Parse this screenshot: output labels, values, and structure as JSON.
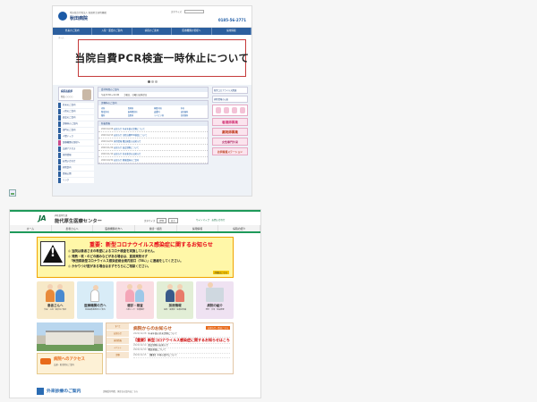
{
  "shot1": {
    "subtitle": "地方独立行政法人 秋田県立病院機構",
    "name": "秋田病院",
    "font_size_label": "文字サイズ",
    "phone": "0185-56-2771",
    "nav": [
      "外来のご案内",
      "入院・面会のご案内",
      "病院のご案内",
      "医療機関の皆様へ",
      "採用情報"
    ],
    "breadcrumb": "ホーム",
    "banner_text": "当院自費PCR検査一時休止について",
    "director": {
      "label": "病院長挨拶",
      "name": "院長 ○○○○"
    },
    "left_nav": [
      {
        "label": "外来のご案内",
        "alt": false
      },
      {
        "label": "入院のご案内",
        "alt": false
      },
      {
        "label": "面会のご案内",
        "alt": false
      },
      {
        "label": "診療科のご案内",
        "alt": false
      },
      {
        "label": "部門のご案内",
        "alt": false
      },
      {
        "label": "人間ドック",
        "alt": false
      },
      {
        "label": "医療機関の皆様へ",
        "alt": true
      },
      {
        "label": "交通アクセス",
        "alt": false
      },
      {
        "label": "採用情報",
        "alt": false
      },
      {
        "label": "お問い合わせ",
        "alt": false
      },
      {
        "label": "病院案内",
        "alt": false
      },
      {
        "label": "情報公開",
        "alt": false
      },
      {
        "label": "リンク",
        "alt": false
      }
    ],
    "hours_box": {
      "heading": "受付時間のご案内",
      "row": "午前 8:30〜11:00　　土曜日、日曜日は休診日"
    },
    "dept_box": {
      "heading": "診療科のご案内",
      "items": [
        "内科",
        "精神科",
        "神経内科",
        "外科",
        "整形外科",
        "脳神経外科",
        "皮膚科",
        "泌尿器科",
        "眼科",
        "耳鼻科",
        "リハビリ科",
        "放射線科"
      ]
    },
    "news_box": {
      "heading": "新着情報",
      "items": [
        {
          "date": "2020/12/28",
          "title": "お知らせ 年末年始の診療について"
        },
        {
          "date": "2020/12/15",
          "title": "お知らせ 当院自費PCR検査について"
        },
        {
          "date": "2020/12/01",
          "title": "採用情報 職員募集のお知らせ"
        },
        {
          "date": "2020/11/20",
          "title": "お知らせ 面会制限について"
        },
        {
          "date": "2020/11/10",
          "title": "お知らせ 外来休診のお知らせ"
        },
        {
          "date": "2020/10/30",
          "title": "お知らせ 健康講座のご案内"
        }
      ]
    },
    "right": {
      "box1": "新型コロナウイルス関連",
      "box2": "病院情報の公表",
      "pink1": "看護師募集",
      "pink2": "薬剤師募集",
      "pink3": "女性専門外来",
      "pink4": "訪問看護ステーション"
    }
  },
  "shot2": {
    "logo": "JA",
    "subtitle": "JA秋田厚生連",
    "name": "能代厚生医療センター",
    "font_label": "文字サイズ",
    "font_buttons": [
      "標準",
      "拡大"
    ],
    "links": "サイトマップ　お問い合わせ",
    "nav": [
      "ホーム",
      "患者さんへ",
      "医療機関の方へ",
      "健診・検査",
      "採用情報",
      "病院の紹介"
    ],
    "alert": {
      "title": "重要：新型コロナウイルス感染症に関するお知らせ",
      "lines": [
        "◎ 当院は患者さまの希望によるコロナ検査を実施していません。",
        "◎ 発熱・咳・のどの痛みなどがある場合は、直接来院せず",
        "　「秋田県新型コロナウイルス感染症総合案内窓口（TEL）」に連絡をしてください。",
        "◎ かかりつけ医がある場合はまずそちらにご相談ください。"
      ],
      "more": "詳細はこちら"
    },
    "cards": [
      {
        "label": "患者さんへ",
        "desc": "外来・入院・面会のご案内"
      },
      {
        "label": "医療機関の方へ",
        "desc": "地域医療連携室のご案内"
      },
      {
        "label": "健診・検査",
        "desc": "人間ドック・各種健診"
      },
      {
        "label": "採用情報",
        "desc": "医師・看護師・医療技術職"
      },
      {
        "label": "病院の紹介",
        "desc": "理念・沿革・施設概要"
      }
    ],
    "access": {
      "title": "病院へのアクセス",
      "sub": "交通・駐車場のご案内"
    },
    "news": {
      "tabs": [
        "すべて",
        "お知らせ",
        "採用情報",
        "イベント",
        "診療"
      ],
      "heading": "病院からのお知らせ",
      "button": "お知らせ一覧はこちら",
      "items": [
        {
          "date": "2020/12/28",
          "title": "年末年始の外来診療について",
          "highlight": false
        },
        {
          "date": "",
          "title": "【重要】新型コロナウイルス感染症に関するお知らせはこちら",
          "highlight": true
        },
        {
          "date": "2020/12/10",
          "title": "面会制限のお知らせ",
          "highlight": false
        },
        {
          "date": "2020/11/30",
          "title": "職員募集について",
          "highlight": false
        },
        {
          "date": "2020/11/15",
          "title": "【重要】手術の受付について",
          "highlight": false
        }
      ]
    },
    "outpatient": {
      "title": "外来診療のご案内",
      "sub": "診療受付時間、休診日の案内はこちら"
    }
  }
}
